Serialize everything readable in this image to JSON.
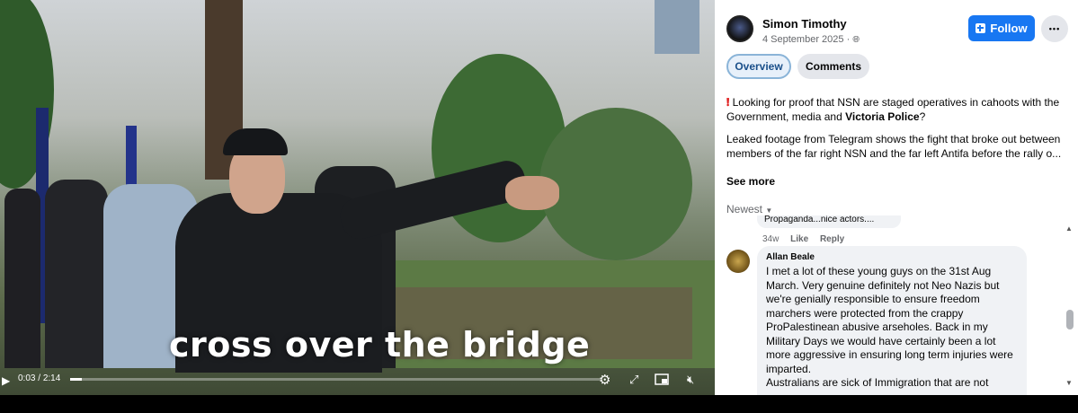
{
  "video": {
    "caption": "cross over the bridge",
    "time_current": "0:03",
    "time_total": "2:14",
    "progress": 0.022
  },
  "post": {
    "author": "Simon Timothy",
    "date": "4 September 2025 ·",
    "follow_label": "Follow",
    "more_label": "•••",
    "tabs": [
      "Overview",
      "Comments"
    ],
    "body_part1": "Looking for proof that NSN are staged operatives in cahoots with the Government, media and ",
    "body_bold": "Victoria Police",
    "body_part1_end": "?",
    "body_part2": "Leaked footage from Telegram shows the fight that broke out between members of the far right NSN and the far left Antifa before the rally o...",
    "see_more": "See more",
    "sort_label": "Newest",
    "accent_color": "#1877f2"
  },
  "comments": {
    "previous": {
      "text": "Propaganda...nice actors....",
      "age": "34w",
      "like": "Like",
      "reply": "Reply"
    },
    "current": {
      "author": "Allan Beale",
      "text": "I met a lot of these young guys on the 31st Aug March. Very genuine definitely not Neo Nazis but we're genially responsible to ensure freedom marchers were protected from the crappy ProPalestinean abusive arseholes. Back in my Military Days we would have certainly been a lot more aggressive in ensuring long term injuries were imparted.\nAustralians are sick of Immigration that are not"
    }
  }
}
